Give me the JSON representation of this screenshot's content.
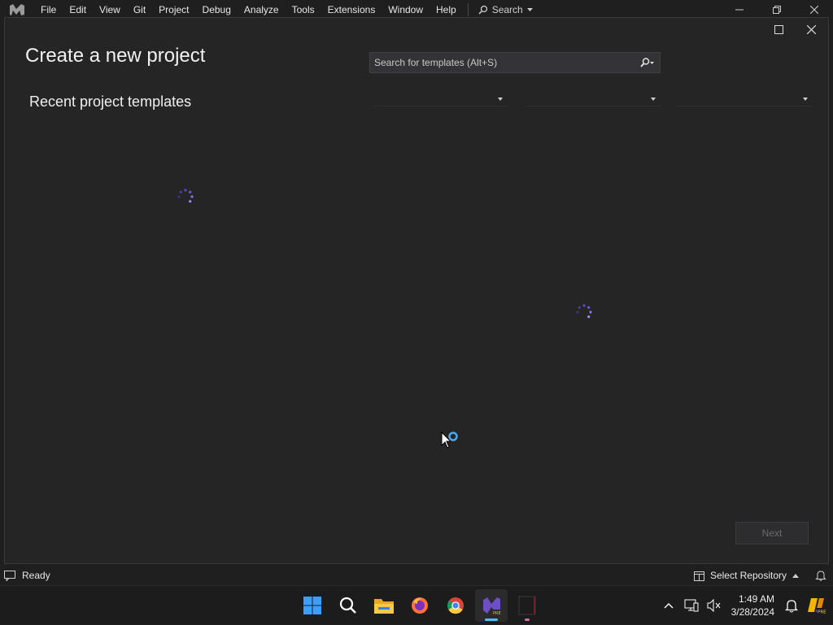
{
  "menubar": {
    "items": [
      "File",
      "Edit",
      "View",
      "Git",
      "Project",
      "Debug",
      "Analyze",
      "Tools",
      "Extensions",
      "Window",
      "Help"
    ],
    "search_label": "Search"
  },
  "dialog": {
    "title": "Create a new project",
    "recent_heading": "Recent project templates",
    "search_placeholder": "Search for templates (Alt+S)",
    "filters": {
      "language": "",
      "platform": "",
      "project_type": ""
    },
    "next_label": "Next"
  },
  "statusbar": {
    "status": "Ready",
    "repo_label": "Select Repository"
  },
  "taskbar": {
    "time": "1:49 AM",
    "date": "3/28/2024",
    "apps": [
      "windows-start",
      "search",
      "file-explorer",
      "firefox",
      "chrome",
      "visual-studio-preview",
      "terminal"
    ]
  },
  "colors": {
    "background": "#1f1f1f",
    "dialog": "#252526",
    "accent_spinner": "#6b5fd6",
    "vs_purple": "#6c4fc7",
    "busy_cursor_ring": "#4aa8f0"
  }
}
